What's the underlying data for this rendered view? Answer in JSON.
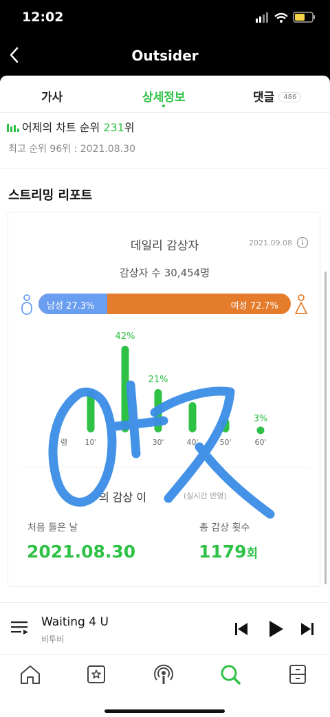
{
  "status": {
    "time": "12:02"
  },
  "nav": {
    "title": "Outsider"
  },
  "tabs": [
    {
      "label": "가사"
    },
    {
      "label": "상세정보"
    },
    {
      "label": "댓글",
      "count": "486"
    }
  ],
  "chart_rank": {
    "prefix": "어제의 차트 순위 ",
    "rank": "231",
    "suffix": "위",
    "best": "최고 순위 96위 : 2021.08.30"
  },
  "section_title": "스트리밍 리포트",
  "daily": {
    "title": "데일리 감상자",
    "date": "2021.09.08",
    "listeners": "감상자 수 30,454명",
    "male_label": "남성 27.3%",
    "female_label": "여성 72.7%",
    "male_ratio": 0.273,
    "colors": {
      "male": "#6a9ef0",
      "female": "#e47c2c",
      "accent": "#2fc145"
    }
  },
  "chart_data": {
    "type": "bar",
    "categories": [
      "10'",
      "20'",
      "30'",
      "40'",
      "50'",
      "60'"
    ],
    "values": [
      null,
      42,
      21,
      null,
      null,
      3
    ],
    "value_labels": [
      "",
      "42%",
      "21%",
      "",
      "",
      "3%"
    ],
    "visible_category_labels": [
      "10'",
      "",
      "30'",
      "40'",
      "50'",
      "60'"
    ],
    "partial_leading_label": "령",
    "title": "",
    "xlabel": "",
    "ylabel": ""
  },
  "my": {
    "label": "의 감상 이",
    "sub": "(실시간 반영)",
    "first_label": "처음 들은 날",
    "first_value": "2021.08.30",
    "total_label": "총 감상 횟수",
    "total_value": "1179",
    "total_unit": "회"
  },
  "player": {
    "title": "Waiting 4 U",
    "artist": "비투비",
    "progress": 0.4
  },
  "icons": [
    "back-icon",
    "chart-icon",
    "info-icon",
    "male-icon",
    "female-icon",
    "playlist-icon",
    "prev-icon",
    "play-icon",
    "next-icon",
    "home-icon",
    "profile-card-icon",
    "podcast-icon",
    "search-icon",
    "storage-icon"
  ]
}
